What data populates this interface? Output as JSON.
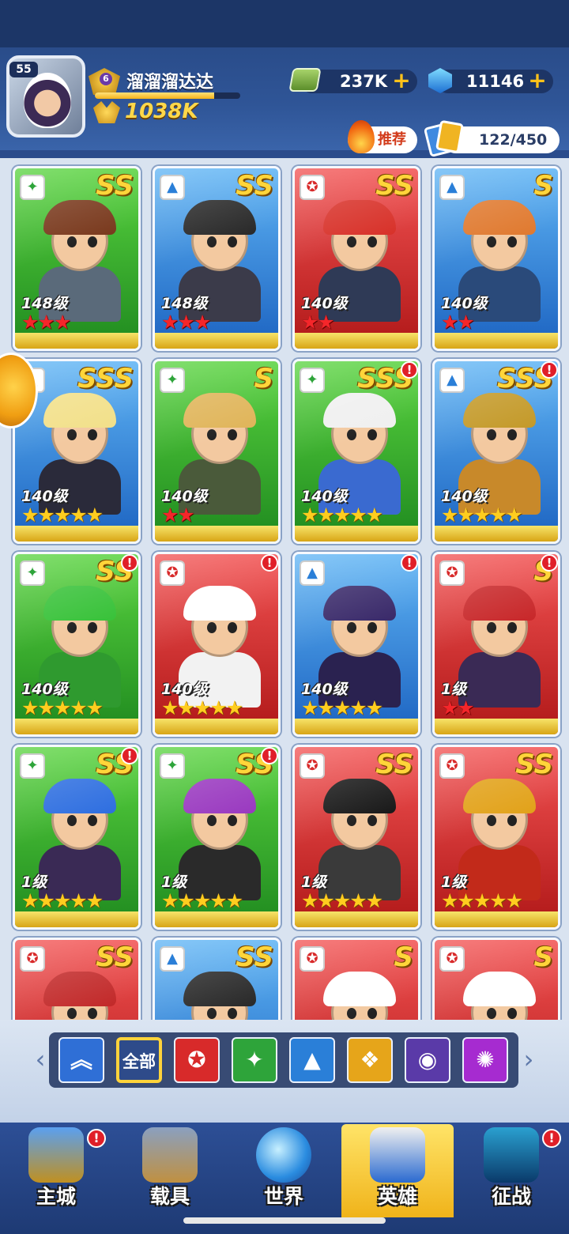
{
  "player": {
    "avatar_level": "55",
    "rank_level": "6",
    "name": "溜溜溜达达",
    "power": "1038K",
    "xp_fraction": 0.82
  },
  "resources": {
    "cash": "237K",
    "gems": "11146",
    "add_symbol": "+"
  },
  "toolbar": {
    "recommend_label": "推荐",
    "hero_count": "122/450"
  },
  "heroes": [
    {
      "grade": "SS",
      "level": "148级",
      "stars": "★★★",
      "star_color": "red",
      "card_color": "green",
      "class": "soldier",
      "alert": false
    },
    {
      "grade": "SS",
      "level": "148级",
      "stars": "★★★",
      "star_color": "red",
      "card_color": "blue",
      "class": "tank",
      "alert": false
    },
    {
      "grade": "SS",
      "level": "140级",
      "stars": "★★",
      "star_color": "red",
      "card_color": "red",
      "class": "assault",
      "alert": false
    },
    {
      "grade": "S",
      "level": "140级",
      "stars": "★★",
      "star_color": "red",
      "card_color": "blue",
      "class": "tank",
      "alert": false
    },
    {
      "grade": "SSS",
      "level": "140级",
      "stars": "★★★★★",
      "star_color": "gold",
      "card_color": "blue",
      "class": "tank",
      "alert": false
    },
    {
      "grade": "S",
      "level": "140级",
      "stars": "★★",
      "star_color": "red",
      "card_color": "green",
      "class": "soldier",
      "alert": false
    },
    {
      "grade": "SSS",
      "level": "140级",
      "stars": "★★★★★",
      "star_color": "gold",
      "card_color": "green",
      "class": "soldier",
      "alert": true
    },
    {
      "grade": "SSS",
      "level": "140级",
      "stars": "★★★★★",
      "star_color": "gold",
      "card_color": "blue",
      "class": "tank",
      "alert": true
    },
    {
      "grade": "SS",
      "level": "140级",
      "stars": "★★★★★",
      "star_color": "gold",
      "card_color": "green",
      "class": "soldier",
      "alert": true
    },
    {
      "grade": "",
      "level": "140级",
      "stars": "★★★★★",
      "star_color": "gold",
      "card_color": "red",
      "class": "assault",
      "alert": true
    },
    {
      "grade": "",
      "level": "140级",
      "stars": "★★★★★",
      "star_color": "gold",
      "card_color": "blue",
      "class": "tank",
      "alert": true
    },
    {
      "grade": "S",
      "level": "1级",
      "stars": "★★",
      "star_color": "red",
      "card_color": "red",
      "class": "assault",
      "alert": true
    },
    {
      "grade": "SS",
      "level": "1级",
      "stars": "★★★★★",
      "star_color": "gold",
      "card_color": "green",
      "class": "soldier",
      "alert": true
    },
    {
      "grade": "SS",
      "level": "1级",
      "stars": "★★★★★",
      "star_color": "gold",
      "card_color": "green",
      "class": "soldier",
      "alert": true
    },
    {
      "grade": "SS",
      "level": "1级",
      "stars": "★★★★★",
      "star_color": "gold",
      "card_color": "red",
      "class": "assault",
      "alert": false
    },
    {
      "grade": "SS",
      "level": "1级",
      "stars": "★★★★★",
      "star_color": "gold",
      "card_color": "red",
      "class": "assault",
      "alert": false
    },
    {
      "grade": "SS",
      "level": "",
      "stars": "",
      "star_color": "red",
      "card_color": "red",
      "class": "assault",
      "alert": false
    },
    {
      "grade": "SS",
      "level": "",
      "stars": "",
      "star_color": "red",
      "card_color": "blue",
      "class": "tank",
      "alert": false
    },
    {
      "grade": "S",
      "level": "",
      "stars": "",
      "star_color": "red",
      "card_color": "red",
      "class": "assault",
      "alert": false
    },
    {
      "grade": "S",
      "level": "",
      "stars": "",
      "star_color": "red",
      "card_color": "red",
      "class": "assault",
      "alert": false
    }
  ],
  "filters": [
    {
      "id": "sort",
      "label": "",
      "icon": "chevron-up-icon",
      "color": "#2f6fd6",
      "selected": false
    },
    {
      "id": "all",
      "label": "全部",
      "icon": "",
      "color": "#2e4b8a",
      "selected": true
    },
    {
      "id": "assault",
      "label": "",
      "icon": "assault-class-icon",
      "color": "#d82a2a",
      "selected": false
    },
    {
      "id": "soldier",
      "label": "",
      "icon": "soldier-class-icon",
      "color": "#2ea43a",
      "selected": false
    },
    {
      "id": "tank",
      "label": "",
      "icon": "tank-class-icon",
      "color": "#2a7fd8",
      "selected": false
    },
    {
      "id": "support",
      "label": "",
      "icon": "support-class-icon",
      "color": "#e6a51a",
      "selected": false
    },
    {
      "id": "special",
      "label": "",
      "icon": "special-class-icon",
      "color": "#5a3aa8",
      "selected": false
    },
    {
      "id": "mystic",
      "label": "",
      "icon": "mystic-class-icon",
      "color": "#a62bd0",
      "selected": false
    }
  ],
  "nav": [
    {
      "label": "主城",
      "icon": "castle-icon",
      "alert": true,
      "active": false
    },
    {
      "label": "载具",
      "icon": "vehicle-icon",
      "alert": false,
      "active": false
    },
    {
      "label": "世界",
      "icon": "globe-icon",
      "alert": false,
      "active": false
    },
    {
      "label": "英雄",
      "icon": "hero-icon",
      "alert": false,
      "active": true
    },
    {
      "label": "征战",
      "icon": "radar-icon",
      "alert": true,
      "active": false
    }
  ],
  "alert_symbol": "!",
  "colors": {
    "card_green": "#35b02f",
    "card_blue": "#3a8ee0",
    "card_red": "#d93333",
    "gold": "#ffcd1f",
    "nav_active": "#f5c22a"
  }
}
